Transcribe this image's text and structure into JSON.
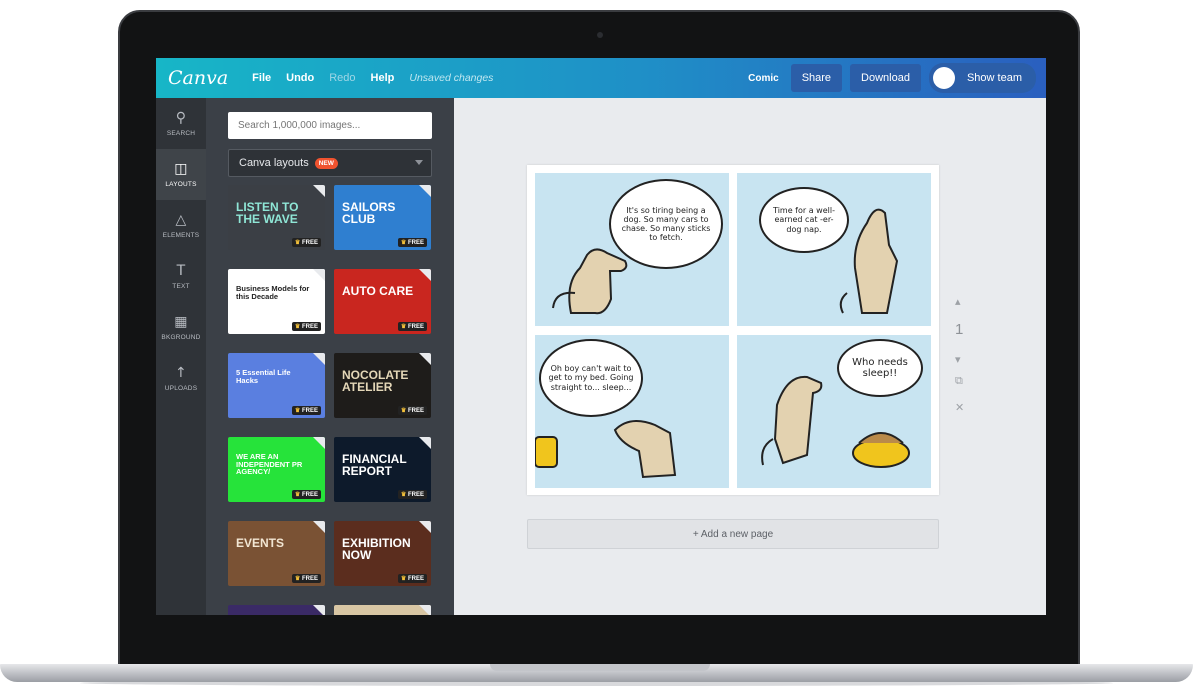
{
  "app": {
    "logo": "Canva",
    "menu": [
      {
        "label": "File",
        "dim": false
      },
      {
        "label": "Undo",
        "dim": false
      },
      {
        "label": "Redo",
        "dim": true
      },
      {
        "label": "Help",
        "dim": false
      }
    ],
    "status": "Unsaved changes",
    "doc_name": "Comic",
    "share_label": "Share",
    "download_label": "Download",
    "team_label": "Show team"
  },
  "tools": [
    {
      "label": "SEARCH",
      "icon": "search-icon",
      "glyph": "⚲"
    },
    {
      "label": "LAYOUTS",
      "icon": "layouts-icon",
      "glyph": "◫"
    },
    {
      "label": "ELEMENTS",
      "icon": "elements-icon",
      "glyph": "△"
    },
    {
      "label": "TEXT",
      "icon": "text-icon",
      "glyph": "T"
    },
    {
      "label": "BKGROUND",
      "icon": "background-icon",
      "glyph": "▦"
    },
    {
      "label": "UPLOADS",
      "icon": "uploads-icon",
      "glyph": "↑"
    }
  ],
  "panel": {
    "search_placeholder": "Search 1,000,000 images...",
    "layout_select": "Canva layouts",
    "new_badge": "NEW",
    "free_label": "FREE",
    "thumbs": [
      {
        "title": "LISTEN TO THE WAVE",
        "bg": "#3b3f45",
        "fg": "#8fe6d6"
      },
      {
        "title": "SAILORS CLUB",
        "bg": "#2f7fd0",
        "fg": "#ffffff"
      },
      {
        "title": "Business Models for this Decade",
        "bg": "#ffffff",
        "fg": "#222222"
      },
      {
        "title": "AUTO CARE",
        "bg": "#c9261f",
        "fg": "#ffffff"
      },
      {
        "title": "5 Essential Life Hacks",
        "bg": "#5a7fe0",
        "fg": "#ffffff"
      },
      {
        "title": "NOCOLATE ATELIER",
        "bg": "#1e1c1a",
        "fg": "#e4d7b8"
      },
      {
        "title": "WE ARE AN INDEPENDENT PR AGENCY/",
        "bg": "#26e33a",
        "fg": "#ffffff"
      },
      {
        "title": "FINANCIAL REPORT",
        "bg": "#0d1a2b",
        "fg": "#ffffff"
      },
      {
        "title": "EVENTS",
        "bg": "#7a5234",
        "fg": "#f2e6d3"
      },
      {
        "title": "EXHIBITION NOW",
        "bg": "#5b2d1e",
        "fg": "#ffffff"
      }
    ]
  },
  "comic": {
    "bubbles": [
      "It's so tiring being a dog. So many cars to chase. So many sticks to fetch.",
      "Time for a well-earned cat -er- dog nap.",
      "Oh boy can't wait to get to my bed. Going straight to... sleep...",
      "Who needs sleep!!"
    ]
  },
  "add_page_label": "+ Add a new page",
  "page_number": "1",
  "colors": {
    "topbar_start": "#17b6c7",
    "topbar_end": "#2a5fbf",
    "panel_bg": "#3b4047",
    "comic_bg": "#c8e4f1"
  }
}
